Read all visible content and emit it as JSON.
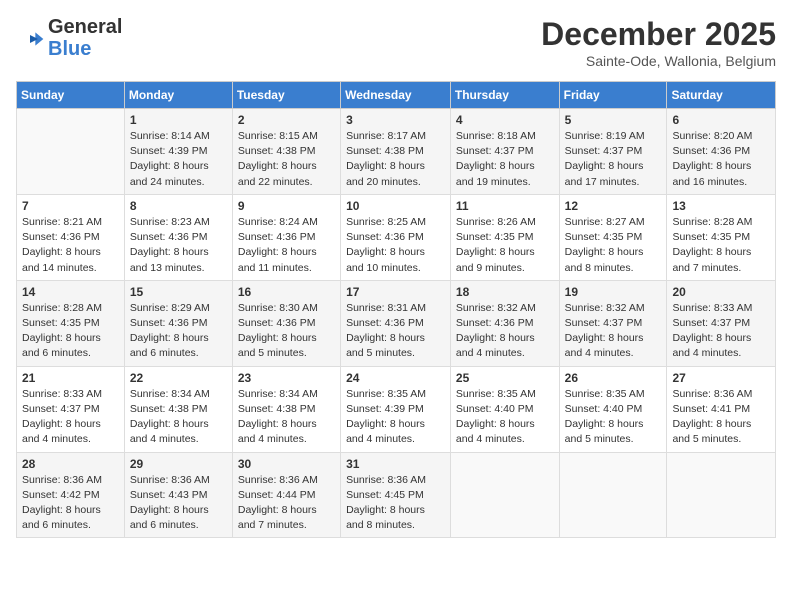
{
  "logo": {
    "line1": "General",
    "line2": "Blue"
  },
  "title": "December 2025",
  "subtitle": "Sainte-Ode, Wallonia, Belgium",
  "days_header": [
    "Sunday",
    "Monday",
    "Tuesday",
    "Wednesday",
    "Thursday",
    "Friday",
    "Saturday"
  ],
  "weeks": [
    [
      {
        "num": "",
        "info": ""
      },
      {
        "num": "1",
        "info": "Sunrise: 8:14 AM\nSunset: 4:39 PM\nDaylight: 8 hours\nand 24 minutes."
      },
      {
        "num": "2",
        "info": "Sunrise: 8:15 AM\nSunset: 4:38 PM\nDaylight: 8 hours\nand 22 minutes."
      },
      {
        "num": "3",
        "info": "Sunrise: 8:17 AM\nSunset: 4:38 PM\nDaylight: 8 hours\nand 20 minutes."
      },
      {
        "num": "4",
        "info": "Sunrise: 8:18 AM\nSunset: 4:37 PM\nDaylight: 8 hours\nand 19 minutes."
      },
      {
        "num": "5",
        "info": "Sunrise: 8:19 AM\nSunset: 4:37 PM\nDaylight: 8 hours\nand 17 minutes."
      },
      {
        "num": "6",
        "info": "Sunrise: 8:20 AM\nSunset: 4:36 PM\nDaylight: 8 hours\nand 16 minutes."
      }
    ],
    [
      {
        "num": "7",
        "info": "Sunrise: 8:21 AM\nSunset: 4:36 PM\nDaylight: 8 hours\nand 14 minutes."
      },
      {
        "num": "8",
        "info": "Sunrise: 8:23 AM\nSunset: 4:36 PM\nDaylight: 8 hours\nand 13 minutes."
      },
      {
        "num": "9",
        "info": "Sunrise: 8:24 AM\nSunset: 4:36 PM\nDaylight: 8 hours\nand 11 minutes."
      },
      {
        "num": "10",
        "info": "Sunrise: 8:25 AM\nSunset: 4:36 PM\nDaylight: 8 hours\nand 10 minutes."
      },
      {
        "num": "11",
        "info": "Sunrise: 8:26 AM\nSunset: 4:35 PM\nDaylight: 8 hours\nand 9 minutes."
      },
      {
        "num": "12",
        "info": "Sunrise: 8:27 AM\nSunset: 4:35 PM\nDaylight: 8 hours\nand 8 minutes."
      },
      {
        "num": "13",
        "info": "Sunrise: 8:28 AM\nSunset: 4:35 PM\nDaylight: 8 hours\nand 7 minutes."
      }
    ],
    [
      {
        "num": "14",
        "info": "Sunrise: 8:28 AM\nSunset: 4:35 PM\nDaylight: 8 hours\nand 6 minutes."
      },
      {
        "num": "15",
        "info": "Sunrise: 8:29 AM\nSunset: 4:36 PM\nDaylight: 8 hours\nand 6 minutes."
      },
      {
        "num": "16",
        "info": "Sunrise: 8:30 AM\nSunset: 4:36 PM\nDaylight: 8 hours\nand 5 minutes."
      },
      {
        "num": "17",
        "info": "Sunrise: 8:31 AM\nSunset: 4:36 PM\nDaylight: 8 hours\nand 5 minutes."
      },
      {
        "num": "18",
        "info": "Sunrise: 8:32 AM\nSunset: 4:36 PM\nDaylight: 8 hours\nand 4 minutes."
      },
      {
        "num": "19",
        "info": "Sunrise: 8:32 AM\nSunset: 4:37 PM\nDaylight: 8 hours\nand 4 minutes."
      },
      {
        "num": "20",
        "info": "Sunrise: 8:33 AM\nSunset: 4:37 PM\nDaylight: 8 hours\nand 4 minutes."
      }
    ],
    [
      {
        "num": "21",
        "info": "Sunrise: 8:33 AM\nSunset: 4:37 PM\nDaylight: 8 hours\nand 4 minutes."
      },
      {
        "num": "22",
        "info": "Sunrise: 8:34 AM\nSunset: 4:38 PM\nDaylight: 8 hours\nand 4 minutes."
      },
      {
        "num": "23",
        "info": "Sunrise: 8:34 AM\nSunset: 4:38 PM\nDaylight: 8 hours\nand 4 minutes."
      },
      {
        "num": "24",
        "info": "Sunrise: 8:35 AM\nSunset: 4:39 PM\nDaylight: 8 hours\nand 4 minutes."
      },
      {
        "num": "25",
        "info": "Sunrise: 8:35 AM\nSunset: 4:40 PM\nDaylight: 8 hours\nand 4 minutes."
      },
      {
        "num": "26",
        "info": "Sunrise: 8:35 AM\nSunset: 4:40 PM\nDaylight: 8 hours\nand 5 minutes."
      },
      {
        "num": "27",
        "info": "Sunrise: 8:36 AM\nSunset: 4:41 PM\nDaylight: 8 hours\nand 5 minutes."
      }
    ],
    [
      {
        "num": "28",
        "info": "Sunrise: 8:36 AM\nSunset: 4:42 PM\nDaylight: 8 hours\nand 6 minutes."
      },
      {
        "num": "29",
        "info": "Sunrise: 8:36 AM\nSunset: 4:43 PM\nDaylight: 8 hours\nand 6 minutes."
      },
      {
        "num": "30",
        "info": "Sunrise: 8:36 AM\nSunset: 4:44 PM\nDaylight: 8 hours\nand 7 minutes."
      },
      {
        "num": "31",
        "info": "Sunrise: 8:36 AM\nSunset: 4:45 PM\nDaylight: 8 hours\nand 8 minutes."
      },
      {
        "num": "",
        "info": ""
      },
      {
        "num": "",
        "info": ""
      },
      {
        "num": "",
        "info": ""
      }
    ]
  ]
}
